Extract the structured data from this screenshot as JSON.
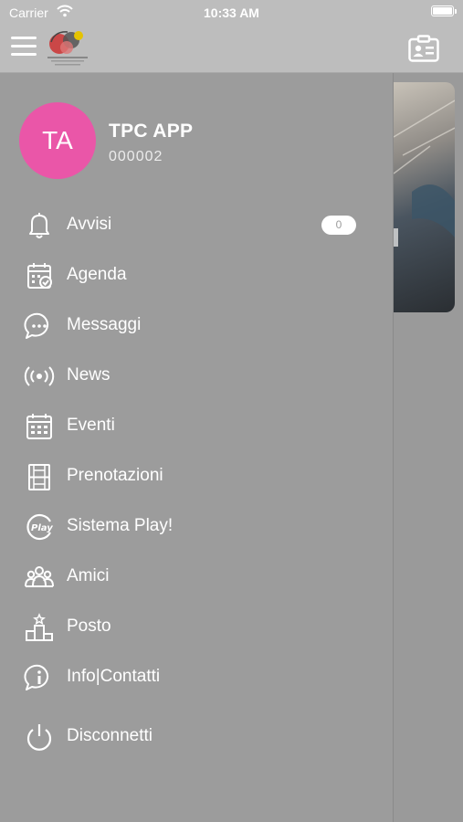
{
  "status_bar": {
    "carrier": "Carrier",
    "time": "10:33 AM",
    "battery_level": 1.0
  },
  "header": {
    "menu_icon": "hamburger-icon",
    "logo": "club-logo",
    "right_icon": "id-card-icon"
  },
  "user": {
    "initials": "TA",
    "name": "TPC APP",
    "id": "000002",
    "avatar_color": "#ea56a8"
  },
  "menu": [
    {
      "label": "Avvisi",
      "icon": "bell-icon",
      "badge": "0"
    },
    {
      "label": "Agenda",
      "icon": "calendar-check-icon"
    },
    {
      "label": "Messaggi",
      "icon": "chat-bubble-icon"
    },
    {
      "label": "News",
      "icon": "broadcast-icon"
    },
    {
      "label": "Eventi",
      "icon": "calendar-grid-icon"
    },
    {
      "label": "Prenotazioni",
      "icon": "court-booking-icon"
    },
    {
      "label": "Sistema Play!",
      "icon": "play-icon"
    },
    {
      "label": "Amici",
      "icon": "friends-icon"
    },
    {
      "label": "Posto",
      "icon": "podium-icon"
    },
    {
      "label": "Info|Contatti",
      "icon": "info-icon"
    },
    {
      "label": "Disconnetti",
      "icon": "power-icon"
    }
  ],
  "colors": {
    "drawer": "#9c9c9c",
    "header": "#bdbdbd",
    "text": "#ffffff"
  }
}
